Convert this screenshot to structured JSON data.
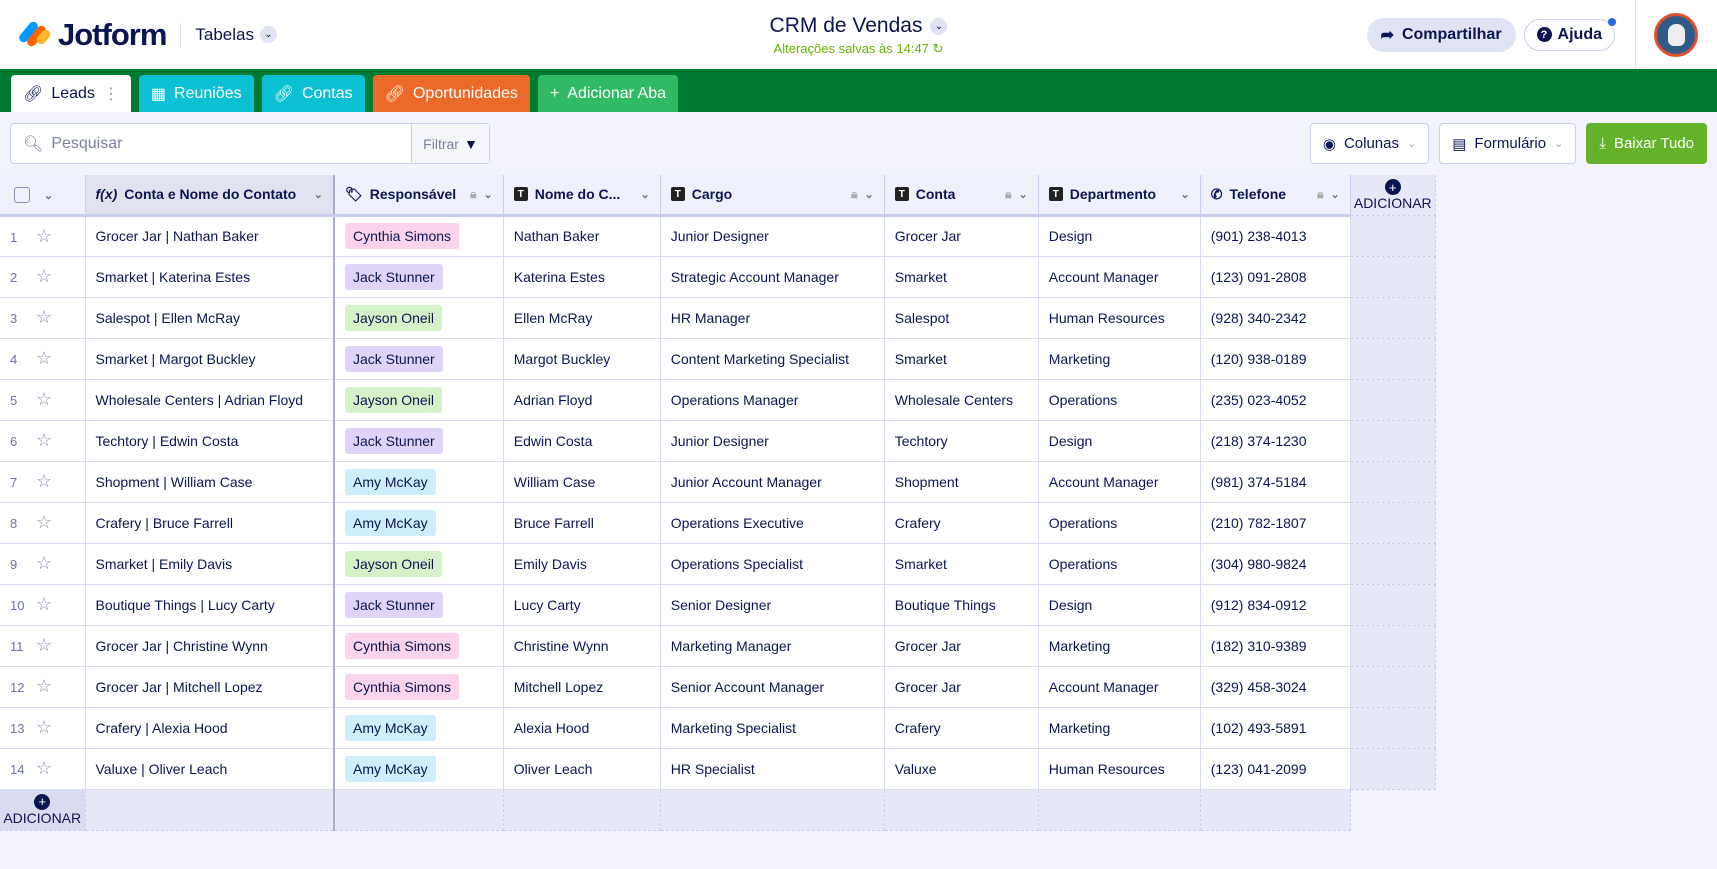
{
  "header": {
    "brand": "Jotform",
    "product": "Tabelas",
    "title": "CRM de Vendas",
    "saved": "Alterações salvas às 14:47",
    "share": "Compartilhar",
    "help": "Ajuda"
  },
  "tabs": [
    {
      "label": "Leads",
      "color": "#ffffff"
    },
    {
      "label": "Reuniões",
      "color": "#0bc0d3"
    },
    {
      "label": "Contas",
      "color": "#0bc0d3"
    },
    {
      "label": "Oportunidades",
      "color": "#eb6a29"
    },
    {
      "label": "Adicionar Aba",
      "color": "#2fba63"
    }
  ],
  "toolbar": {
    "search_placeholder": "Pesquisar",
    "filter": "Filtrar",
    "columns": "Colunas",
    "form": "Formulário",
    "download": "Baixar Tudo"
  },
  "columns": [
    "Conta e Nome do Contato",
    "Responsável",
    "Nome do C...",
    "Cargo",
    "Conta",
    "Departmento",
    "Telefone"
  ],
  "add_label": "ADICIONAR",
  "owner_colors": {
    "Cynthia Simons": "#fbd3ec",
    "Jack Stunner": "#dfd3f7",
    "Jayson Oneil": "#d4f2c8",
    "Amy McKay": "#cdeefa"
  },
  "rows": [
    [
      "1",
      "Grocer Jar | Nathan Baker",
      "Cynthia Simons",
      "Nathan Baker",
      "Junior Designer",
      "Grocer Jar",
      "Design",
      "(901) 238-4013"
    ],
    [
      "2",
      "Smarket | Katerina Estes",
      "Jack Stunner",
      "Katerina Estes",
      "Strategic Account Manager",
      "Smarket",
      "Account Manager",
      "(123) 091-2808"
    ],
    [
      "3",
      "Salespot | Ellen McRay",
      "Jayson Oneil",
      "Ellen McRay",
      "HR Manager",
      "Salespot",
      "Human Resources",
      "(928) 340-2342"
    ],
    [
      "4",
      "Smarket | Margot Buckley",
      "Jack Stunner",
      "Margot Buckley",
      "Content Marketing Specialist",
      "Smarket",
      "Marketing",
      "(120) 938-0189"
    ],
    [
      "5",
      "Wholesale Centers | Adrian Floyd",
      "Jayson Oneil",
      "Adrian Floyd",
      "Operations Manager",
      "Wholesale Centers",
      "Operations",
      "(235) 023-4052"
    ],
    [
      "6",
      "Techtory | Edwin Costa",
      "Jack Stunner",
      "Edwin Costa",
      "Junior Designer",
      "Techtory",
      "Design",
      "(218) 374-1230"
    ],
    [
      "7",
      "Shopment | William Case",
      "Amy McKay",
      "William Case",
      "Junior Account Manager",
      "Shopment",
      "Account Manager",
      "(981) 374-5184"
    ],
    [
      "8",
      "Crafery | Bruce Farrell",
      "Amy McKay",
      "Bruce Farrell",
      "Operations Executive",
      "Crafery",
      "Operations",
      "(210) 782-1807"
    ],
    [
      "9",
      "Smarket | Emily Davis",
      "Jayson Oneil",
      "Emily Davis",
      "Operations Specialist",
      "Smarket",
      "Operations",
      "(304) 980-9824"
    ],
    [
      "10",
      "Boutique Things | Lucy Carty",
      "Jack Stunner",
      "Lucy Carty",
      "Senior Designer",
      "Boutique Things",
      "Design",
      "(912) 834-0912"
    ],
    [
      "11",
      "Grocer Jar | Christine Wynn",
      "Cynthia Simons",
      "Christine Wynn",
      "Marketing Manager",
      "Grocer Jar",
      "Marketing",
      "(182) 310-9389"
    ],
    [
      "12",
      "Grocer Jar | Mitchell Lopez",
      "Cynthia Simons",
      "Mitchell Lopez",
      "Senior Account Manager",
      "Grocer Jar",
      "Account Manager",
      "(329) 458-3024"
    ],
    [
      "13",
      "Crafery | Alexia Hood",
      "Amy McKay",
      "Alexia Hood",
      "Marketing Specialist",
      "Crafery",
      "Marketing",
      "(102) 493-5891"
    ],
    [
      "14",
      "Valuxe | Oliver Leach",
      "Amy McKay",
      "Oliver Leach",
      "HR Specialist",
      "Valuxe",
      "Human Resources",
      "(123) 041-2099"
    ]
  ]
}
